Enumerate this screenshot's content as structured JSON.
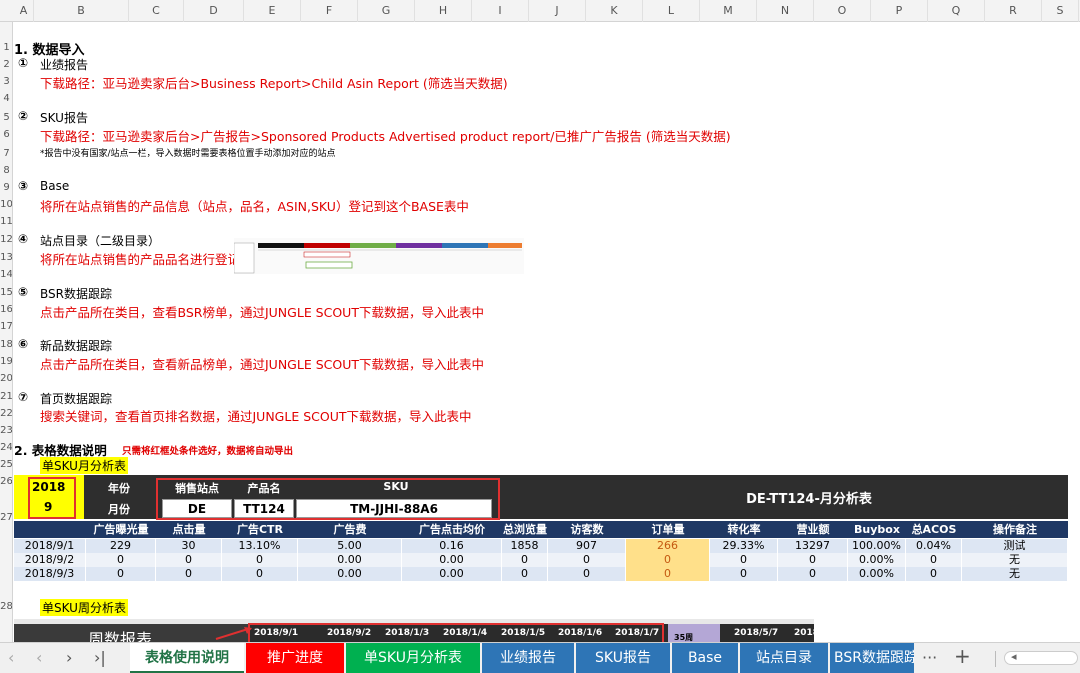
{
  "columns": [
    "A",
    "B",
    "C",
    "D",
    "E",
    "F",
    "G",
    "H",
    "I",
    "J",
    "K",
    "L",
    "M",
    "N",
    "O",
    "P",
    "Q",
    "R",
    "S"
  ],
  "rows": [
    "",
    "1",
    "2",
    "3",
    "4",
    "5",
    "6",
    "7",
    "8",
    "9",
    "10",
    "11",
    "12",
    "13",
    "14",
    "15",
    "16",
    "17",
    "18",
    "19",
    "20",
    "21",
    "22",
    "23",
    "24",
    "25",
    "26",
    "27",
    "28"
  ],
  "section1": {
    "title": "1. 数据导入",
    "items": [
      {
        "num": "①",
        "name": "业绩报告",
        "desc": "下载路径：亚马逊卖家后台>Business Report>Child Asin Report (筛选当天数据)"
      },
      {
        "num": "②",
        "name": "SKU报告",
        "desc": "下载路径：亚马逊卖家后台>广告报告>Sponsored Products Advertised product report/已推广广告报告 (筛选当天数据)",
        "note": "*报告中没有国家/站点一栏，导入数据时需要表格位置手动添加对应的站点"
      },
      {
        "num": "③",
        "name": "Base",
        "desc": "将所在站点销售的产品信息（站点，品名，ASIN,SKU）登记到这个BASE表中"
      },
      {
        "num": "④",
        "name": "站点目录（二级目录）",
        "desc": "将所在站点销售的产品品名进行登记"
      },
      {
        "num": "⑤",
        "name": "BSR数据跟踪",
        "desc": "点击产品所在类目，查看BSR榜单，通过JUNGLE SCOUT下载数据，导入此表中"
      },
      {
        "num": "⑥",
        "name": "新品数据跟踪",
        "desc": "点击产品所在类目，查看新品榜单，通过JUNGLE SCOUT下载数据，导入此表中"
      },
      {
        "num": "⑦",
        "name": "首页数据跟踪",
        "desc": "搜索关键词，查看首页排名数据，通过JUNGLE SCOUT下载数据，导入此表中"
      }
    ]
  },
  "section2": {
    "title": "2. 表格数据说明",
    "hint": "只需将红框处条件选好，数据将自动导出",
    "table1_label": "单SKU月分析表",
    "table2_label": "单SKU周分析表"
  },
  "table1": {
    "year": "2018",
    "month": "9",
    "year_label": "年份",
    "month_label": "月份",
    "site_label": "销售站点",
    "product_label": "产品名",
    "sku_label": "SKU",
    "site": "DE",
    "product": "TT124",
    "sku": "TM-JJHI-88A6",
    "title": "DE-TT124-月分析表",
    "headers": [
      "广告曝光量",
      "点击量",
      "广告CTR",
      "广告费",
      "广告点击均价",
      "总浏览量",
      "访客数",
      "订单量",
      "转化率",
      "营业额",
      "Buybox",
      "总ACOS",
      "操作备注"
    ],
    "rows": [
      {
        "date": "2018/9/1",
        "cells": [
          "229",
          "30",
          "13.10%",
          "5.00",
          "0.16",
          "1858",
          "907",
          "266",
          "29.33%",
          "13297",
          "100.00%",
          "0.04%",
          "测试"
        ]
      },
      {
        "date": "2018/9/2",
        "cells": [
          "0",
          "0",
          "0",
          "0.00",
          "0.00",
          "0",
          "0",
          "0",
          "0",
          "0",
          "0.00%",
          "0",
          "无"
        ]
      },
      {
        "date": "2018/9/3",
        "cells": [
          "0",
          "0",
          "0",
          "0.00",
          "0.00",
          "0",
          "0",
          "0",
          "0",
          "0",
          "0.00%",
          "0",
          "无"
        ]
      }
    ]
  },
  "table2": {
    "title": "周数报表",
    "dates": [
      "2018/9/1",
      "2018/9/2",
      "2018/1/3",
      "2018/1/4",
      "2018/1/5",
      "2018/1/6",
      "2018/1/7"
    ],
    "week": "35周",
    "more_dates": [
      "2018/5/7",
      "2018"
    ]
  },
  "tabs": [
    {
      "label": "表格使用说明",
      "color": "#ffffff",
      "active": true
    },
    {
      "label": "推广进度",
      "color": "#ff0000"
    },
    {
      "label": "单SKU月分析表",
      "color": "#00b050"
    },
    {
      "label": "业绩报告",
      "color": "#2e75b6"
    },
    {
      "label": "SKU报告",
      "color": "#2e75b6"
    },
    {
      "label": "Base",
      "color": "#2e75b6"
    },
    {
      "label": "站点目录",
      "color": "#2e75b6"
    },
    {
      "label": "BSR数据跟踪",
      "color": "#2e75b6"
    }
  ],
  "tab_nav": {
    "prev": "‹",
    "next": "›",
    "last": "›|",
    "more": "···",
    "add": "+"
  }
}
